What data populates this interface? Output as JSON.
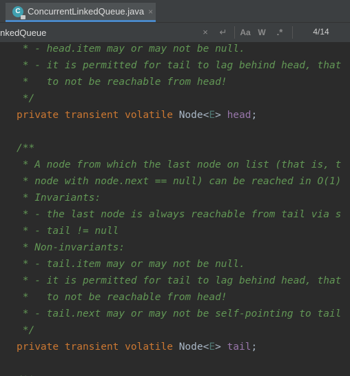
{
  "tab": {
    "icon": "class-c-icon",
    "icon_letter": "C",
    "title": "ConcurrentLinkedQueue.java",
    "close": "×"
  },
  "search": {
    "value": "LinkedQueue",
    "clear_icon": "×",
    "newline_icon": "↵",
    "match_case": "Aa",
    "words": "W",
    "regex": ".*",
    "count": "4/14"
  },
  "code": {
    "lines": [
      [
        [
          "doc",
          " * - head.item may or may not be null."
        ]
      ],
      [
        [
          "doc",
          " * - it is permitted for tail to lag behind head, that"
        ]
      ],
      [
        [
          "doc",
          " *   to not be reachable from head!"
        ]
      ],
      [
        [
          "doc",
          " */"
        ]
      ],
      [
        [
          "kw",
          "private transient volatile "
        ],
        [
          "ty",
          "Node<"
        ],
        [
          "gen",
          "E"
        ],
        [
          "ty",
          "> "
        ],
        [
          "fld",
          "head"
        ],
        [
          "pl",
          ";"
        ]
      ],
      [
        [
          "pl",
          ""
        ]
      ],
      [
        [
          "doc",
          "/**"
        ]
      ],
      [
        [
          "doc",
          " * A node from which the last node on list (that is, t"
        ]
      ],
      [
        [
          "doc",
          " * node with node.next == null) can be reached in O(1)"
        ]
      ],
      [
        [
          "doc",
          " * Invariants:"
        ]
      ],
      [
        [
          "doc",
          " * - the last node is always reachable from tail via s"
        ]
      ],
      [
        [
          "doc",
          " * - tail != null"
        ]
      ],
      [
        [
          "doc",
          " * Non-invariants:"
        ]
      ],
      [
        [
          "doc",
          " * - tail.item may or may not be null."
        ]
      ],
      [
        [
          "doc",
          " * - it is permitted for tail to lag behind head, that"
        ]
      ],
      [
        [
          "doc",
          " *   to not be reachable from head!"
        ]
      ],
      [
        [
          "doc",
          " * - tail.next may or may not be self-pointing to tail"
        ]
      ],
      [
        [
          "doc",
          " */"
        ]
      ],
      [
        [
          "kw",
          "private transient volatile "
        ],
        [
          "ty",
          "Node<"
        ],
        [
          "gen",
          "E"
        ],
        [
          "ty",
          "> "
        ],
        [
          "fld",
          "tail"
        ],
        [
          "pl",
          ";"
        ]
      ],
      [
        [
          "pl",
          ""
        ]
      ],
      [
        [
          "doc",
          "/**"
        ]
      ]
    ]
  },
  "colors": {
    "background": "#2b2b2b",
    "doc_comment": "#629755",
    "keyword": "#cc7832",
    "type": "#a9b7c6",
    "generic": "#507874",
    "field": "#9876aa",
    "tab_accent": "#4a88c7"
  }
}
